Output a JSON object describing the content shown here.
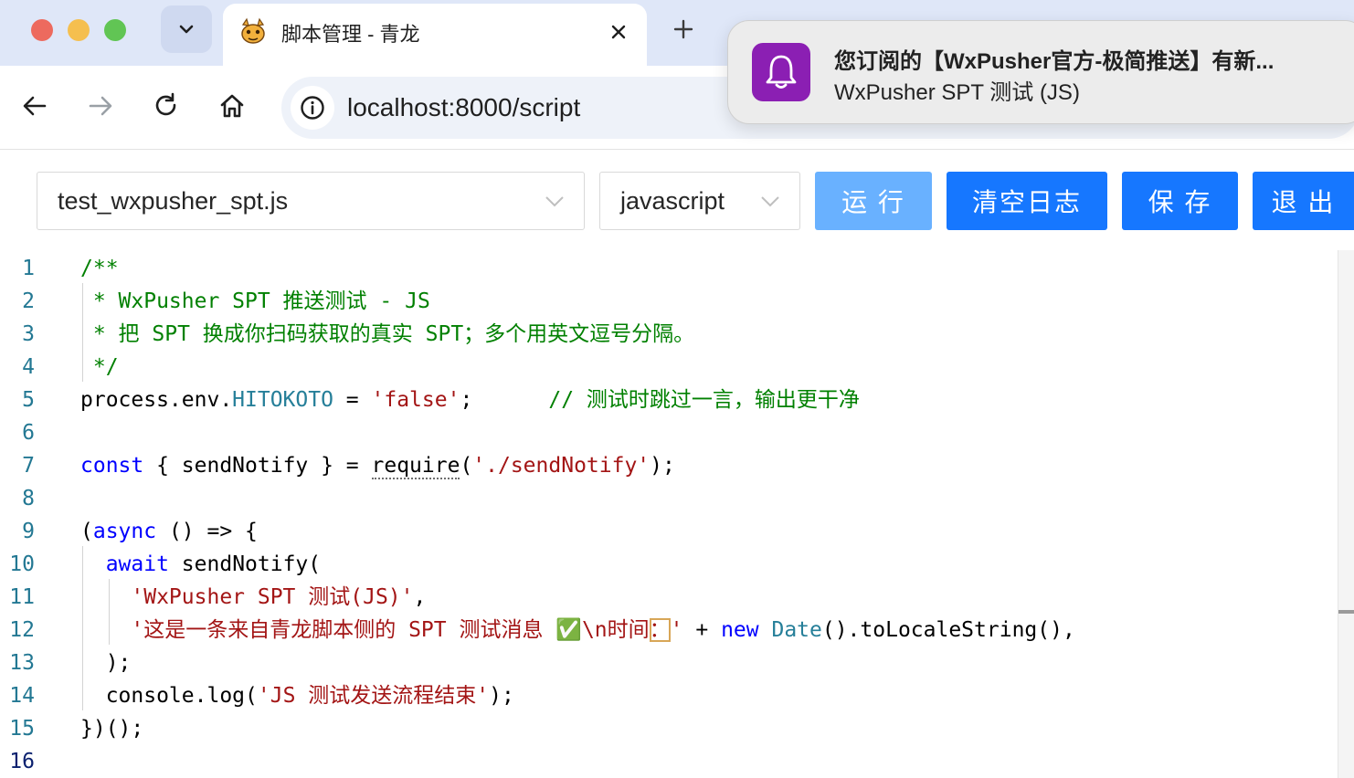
{
  "browser": {
    "tab": {
      "title": "脚本管理 - 青龙",
      "favicon": "qinglong-dragon-icon"
    },
    "url": "localhost:8000/script",
    "icons": {
      "back": "arrow-left-icon",
      "forward": "arrow-right-icon",
      "reload": "reload-icon",
      "home": "home-icon",
      "info": "info-icon",
      "close": "close-icon",
      "new_tab": "plus-icon",
      "tab_list": "chevron-down-icon"
    },
    "colors": {
      "tab_strip": "#dfe7f8",
      "omnibox": "#eef2f9"
    }
  },
  "notification": {
    "title": "您订阅的【WxPusher官方-极简推送】有新...",
    "body": "WxPusher SPT 测试 (JS)",
    "icon": "bell-icon",
    "icon_color": "#8b1fb3"
  },
  "controls": {
    "file_select": {
      "value": "test_wxpusher_spt.js"
    },
    "language_select": {
      "value": "javascript"
    },
    "buttons": {
      "run": "运 行",
      "clear_log": "清空日志",
      "save": "保 存",
      "exit": "退 出"
    },
    "colors": {
      "primary": "#1677ff",
      "primary_light": "#69b1ff"
    }
  },
  "editor": {
    "line_numbers": [
      "1",
      "2",
      "3",
      "4",
      "5",
      "6",
      "7",
      "8",
      "9",
      "10",
      "11",
      "12",
      "13",
      "14",
      "15",
      "16"
    ],
    "current_line": "16",
    "lines": [
      [
        {
          "t": "/**",
          "c": "comment"
        }
      ],
      [
        {
          "t": " * WxPusher SPT 推送测试 - JS",
          "c": "comment"
        }
      ],
      [
        {
          "t": " * 把 SPT 换成你扫码获取的真实 SPT；多个用英文逗号分隔。",
          "c": "comment"
        }
      ],
      [
        {
          "t": " */",
          "c": "comment"
        }
      ],
      [
        {
          "t": "process.env.",
          "c": ""
        },
        {
          "t": "HITOKOTO",
          "c": "prop"
        },
        {
          "t": " = ",
          "c": ""
        },
        {
          "t": "'false'",
          "c": "string"
        },
        {
          "t": ";      ",
          "c": ""
        },
        {
          "t": "// 测试时跳过一言，输出更干净",
          "c": "comment"
        }
      ],
      [],
      [
        {
          "t": "const",
          "c": "keyword"
        },
        {
          "t": " { sendNotify } = ",
          "c": ""
        },
        {
          "t": "require",
          "c": "squiggle"
        },
        {
          "t": "(",
          "c": ""
        },
        {
          "t": "'./sendNotify'",
          "c": "string"
        },
        {
          "t": ");",
          "c": ""
        }
      ],
      [],
      [
        {
          "t": "(",
          "c": ""
        },
        {
          "t": "async",
          "c": "keyword"
        },
        {
          "t": " () => {",
          "c": ""
        }
      ],
      [
        {
          "t": "  ",
          "c": ""
        },
        {
          "t": "await",
          "c": "keyword"
        },
        {
          "t": " sendNotify(",
          "c": ""
        }
      ],
      [
        {
          "t": "    ",
          "c": ""
        },
        {
          "t": "'WxPusher SPT 测试(JS)'",
          "c": "string"
        },
        {
          "t": ",",
          "c": ""
        }
      ],
      [
        {
          "t": "    ",
          "c": ""
        },
        {
          "t": "'这是一条来自青龙脚本侧的 SPT 测试消息 ✅\\n时间",
          "c": "string"
        },
        {
          "t": "：",
          "c": "string hl"
        },
        {
          "t": "'",
          "c": "string"
        },
        {
          "t": " + ",
          "c": ""
        },
        {
          "t": "new",
          "c": "keyword"
        },
        {
          "t": " ",
          "c": ""
        },
        {
          "t": "Date",
          "c": "type"
        },
        {
          "t": "().toLocaleString(),",
          "c": ""
        }
      ],
      [
        {
          "t": "  );",
          "c": ""
        }
      ],
      [
        {
          "t": "  console.log(",
          "c": ""
        },
        {
          "t": "'JS 测试发送流程结束'",
          "c": "string"
        },
        {
          "t": ");",
          "c": ""
        }
      ],
      [
        {
          "t": "})();",
          "c": ""
        }
      ],
      []
    ]
  }
}
